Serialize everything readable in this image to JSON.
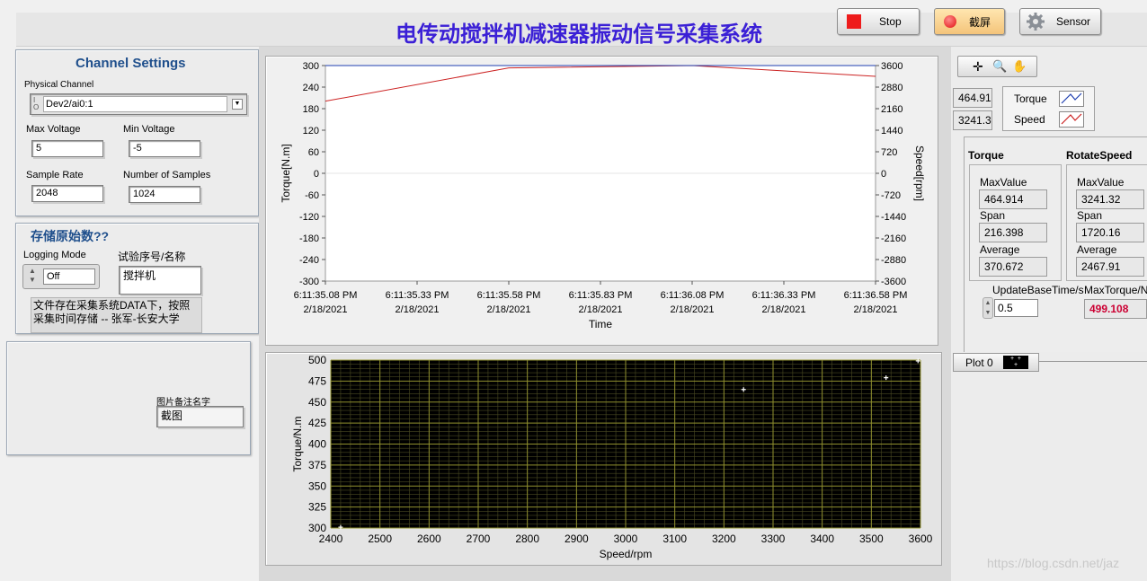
{
  "title": "电传动搅拌机减速器振动信号采集系统",
  "toolbar": {
    "stop_label": "Stop",
    "screenshot_label": "截屏",
    "sensor_label": "Sensor"
  },
  "channel_settings": {
    "title": "Channel Settings",
    "physical_channel_label": "Physical Channel",
    "physical_channel_value": "Dev2/ai0:1",
    "max_voltage_label": "Max Voltage",
    "max_voltage_value": "5",
    "min_voltage_label": "Min Voltage",
    "min_voltage_value": "-5",
    "sample_rate_label": "Sample Rate",
    "sample_rate_value": "2048",
    "num_samples_label": "Number of Samples",
    "num_samples_value": "1024"
  },
  "storage": {
    "title": "存储原始数??",
    "logging_mode_label": "Logging Mode",
    "logging_mode_value": "Off",
    "test_id_label": "试验序号/名称",
    "test_id_value": "搅拌机",
    "note": "文件存在采集系统DATA下，按照采集时间存储 -- 张军-长安大学"
  },
  "image_note": {
    "label": "图片备注名字",
    "value": "截图"
  },
  "readouts": {
    "torque_value": "464.91",
    "speed_value": "3241.32"
  },
  "legend": {
    "torque": "Torque",
    "speed": "Speed"
  },
  "stats": {
    "torque": {
      "header": "Torque",
      "max_label": "MaxValue",
      "max": "464.914",
      "span_label": "Span",
      "span": "216.398",
      "avg_label": "Average",
      "avg": "370.672"
    },
    "rotate": {
      "header": "RotateSpeed",
      "max_label": "MaxValue",
      "max": "3241.32",
      "span_label": "Span",
      "span": "1720.16",
      "avg_label": "Average",
      "avg": "2467.91"
    }
  },
  "update_base_time": {
    "label": "UpdateBaseTime/s",
    "value": "0.5"
  },
  "max_torque": {
    "label": "MaxTorque/N",
    "value": "499.108"
  },
  "plot_legend": {
    "label": "Plot 0"
  },
  "watermark": "https://blog.csdn.net/jaz",
  "colors": {
    "title": "#3b20d6",
    "speed_line": "#cc2222",
    "max_torque": "#cc0033",
    "panel_header": "#1f4f8c"
  },
  "chart_data": [
    {
      "type": "line",
      "xlabel": "Time",
      "ylabel": "Torque[N.m]",
      "y2label": "Speed[rpm]",
      "ylim": [
        -300,
        300
      ],
      "y2lim": [
        -3600,
        3600
      ],
      "yticks": [
        "300",
        "240",
        "180",
        "120",
        "60",
        "0",
        "-60",
        "-120",
        "-180",
        "-240",
        "-300"
      ],
      "y2ticks": [
        "3600",
        "2880",
        "2160",
        "1440",
        "720",
        "0",
        "-720",
        "-1440",
        "-2160",
        "-2880",
        "-3600"
      ],
      "xticks": [
        [
          "6:11:35.08 PM",
          "2/18/2021"
        ],
        [
          "6:11:35.33 PM",
          "2/18/2021"
        ],
        [
          "6:11:35.58 PM",
          "2/18/2021"
        ],
        [
          "6:11:35.83 PM",
          "2/18/2021"
        ],
        [
          "6:11:36.08 PM",
          "2/18/2021"
        ],
        [
          "6:11:36.33 PM",
          "2/18/2021"
        ],
        [
          "6:11:36.58 PM",
          "2/18/2021"
        ]
      ],
      "x": [
        "6:11:35.08 PM",
        "6:11:35.58 PM",
        "6:11:36.08 PM",
        "6:11:36.58 PM"
      ],
      "series": [
        {
          "name": "Speed",
          "axis": "right",
          "values": [
            2410,
            3520,
            3600,
            3240
          ]
        },
        {
          "name": "Torque",
          "axis": "left",
          "values": [
            300,
            300,
            300,
            300
          ]
        }
      ]
    },
    {
      "type": "scatter",
      "xlabel": "Speed/rpm",
      "ylabel": "Torque/N.m",
      "xlim": [
        2400,
        3600
      ],
      "ylim": [
        300,
        500
      ],
      "xticks": [
        "2400",
        "2500",
        "2600",
        "2700",
        "2800",
        "2900",
        "3000",
        "3100",
        "3200",
        "3300",
        "3400",
        "3500",
        "3600"
      ],
      "yticks": [
        "500",
        "475",
        "450",
        "425",
        "400",
        "375",
        "350",
        "325",
        "300"
      ],
      "points": [
        {
          "x": 2420,
          "y": 301
        },
        {
          "x": 3240,
          "y": 465
        },
        {
          "x": 3530,
          "y": 479
        },
        {
          "x": 3595,
          "y": 499
        }
      ]
    }
  ]
}
